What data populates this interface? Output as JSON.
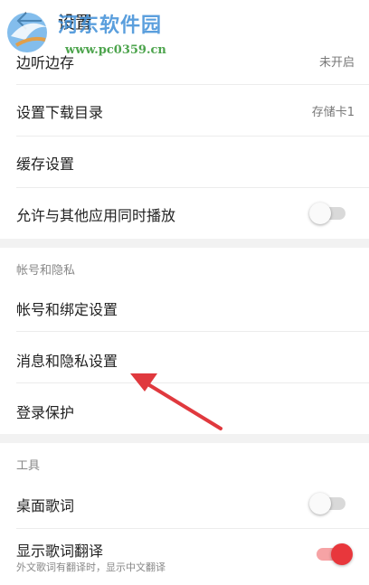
{
  "header": {
    "title": "设置"
  },
  "watermark": {
    "title": "河东软件园",
    "url": "www.pc0359.cn"
  },
  "rows": {
    "listen_cache": {
      "label": "边听边存",
      "value": "未开启"
    },
    "download_dir": {
      "label": "设置下载目录",
      "value": "存储卡1"
    },
    "cache_settings": {
      "label": "缓存设置"
    },
    "allow_concurrent": {
      "label": "允许与其他应用同时播放",
      "enabled": false
    }
  },
  "account_section": {
    "title": "帐号和隐私",
    "items": [
      {
        "label": "帐号和绑定设置"
      },
      {
        "label": "消息和隐私设置"
      },
      {
        "label": "登录保护"
      }
    ]
  },
  "tools_section": {
    "title": "工具",
    "desktop_lyrics": {
      "label": "桌面歌词",
      "enabled": false
    },
    "lyrics_translation": {
      "label": "显示歌词翻译",
      "sublabel": "外文歌词有翻译时，显示中文翻译",
      "enabled": true
    }
  },
  "colors": {
    "accent": "#e8373c",
    "annotation_arrow": "#e0393e",
    "watermark_blue": "#3f8fd8",
    "watermark_green": "#3a9b3a"
  }
}
